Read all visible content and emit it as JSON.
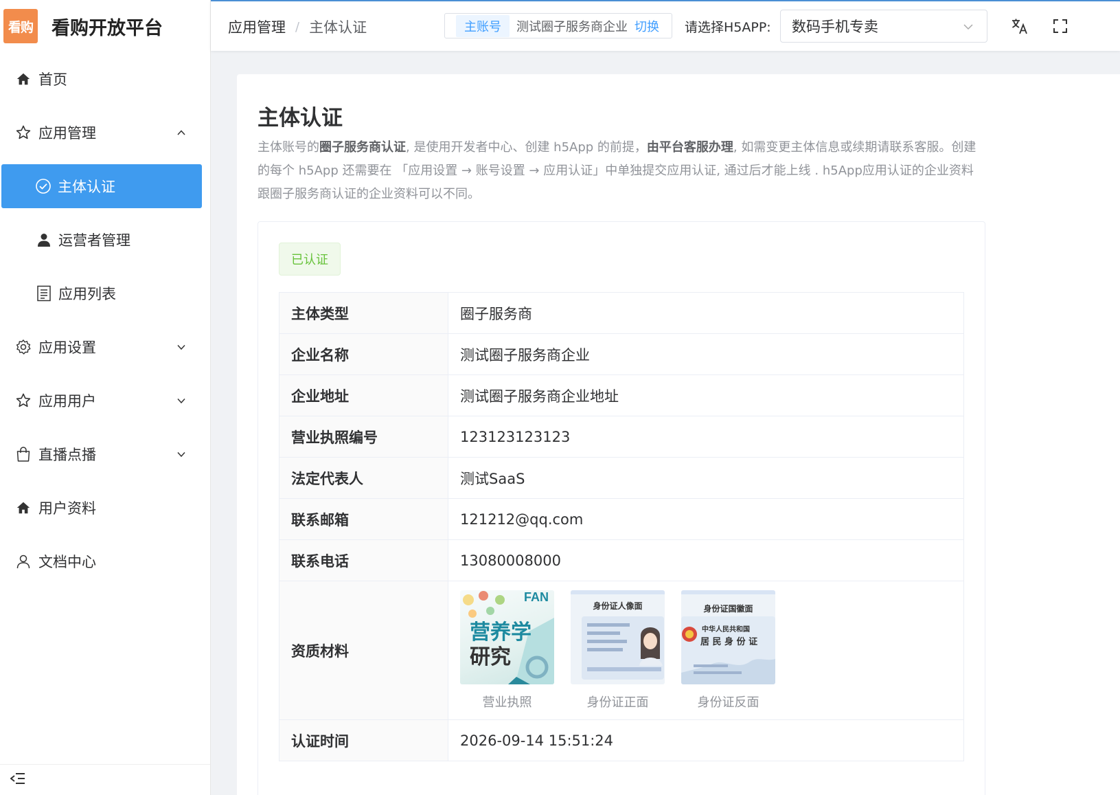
{
  "sidebar": {
    "logo_badge": "看购",
    "logo_title": "看购开放平台",
    "items": [
      {
        "label": "首页"
      },
      {
        "label": "应用管理"
      },
      {
        "label": "主体认证"
      },
      {
        "label": "运营者管理"
      },
      {
        "label": "应用列表"
      },
      {
        "label": "应用设置"
      },
      {
        "label": "应用用户"
      },
      {
        "label": "直播点播"
      },
      {
        "label": "用户资料"
      },
      {
        "label": "文档中心"
      }
    ]
  },
  "header": {
    "breadcrumb": [
      "应用管理",
      "主体认证"
    ],
    "breadcrumb_sep": "/",
    "account_tag": "主账号",
    "account_name": "测试圈子服务商企业",
    "account_switch": "切换",
    "select_label": "请选择H5APP:",
    "select_value": "数码手机专卖"
  },
  "main": {
    "title": "主体认证",
    "desc_parts": [
      "主体账号的",
      "圈子服务商认证",
      ", 是使用开发者中心、创建 h5App 的前提，",
      "由平台客服办理",
      ", 如需变更主体信息或续期请联系客服。创建的每个 h5App 还需要在 「应用设置 → 账号设置 → 应用认证」中单独提交应用认证, 通过后才能上线 . h5App应用认证的企业资料跟圈子服务商认证的企业资料可以不同。"
    ],
    "status": "已认证",
    "rows": [
      {
        "label": "主体类型",
        "value": "圈子服务商"
      },
      {
        "label": "企业名称",
        "value": "测试圈子服务商企业"
      },
      {
        "label": "企业地址",
        "value": "测试圈子服务商企业地址"
      },
      {
        "label": "营业执照编号",
        "value": "123123123123"
      },
      {
        "label": "法定代表人",
        "value": "测试SaaS"
      },
      {
        "label": "联系邮箱",
        "value": "121212@qq.com"
      },
      {
        "label": "联系电话",
        "value": "13080008000"
      }
    ],
    "docs_label": "资质材料",
    "docs": [
      {
        "caption": "营业执照",
        "thumb_line1": "营养学",
        "thumb_line2": "研究",
        "thumb_brand": "FAN"
      },
      {
        "caption": "身份证正面",
        "thumb_title": "身份证人像面"
      },
      {
        "caption": "身份证反面",
        "thumb_title": "身份证国徽面",
        "thumb_line1": "中华人民共和国",
        "thumb_line2": "居 民 身 份 证"
      }
    ],
    "time_label": "认证时间",
    "time_value": "2026-09-14 15:51:24"
  }
}
